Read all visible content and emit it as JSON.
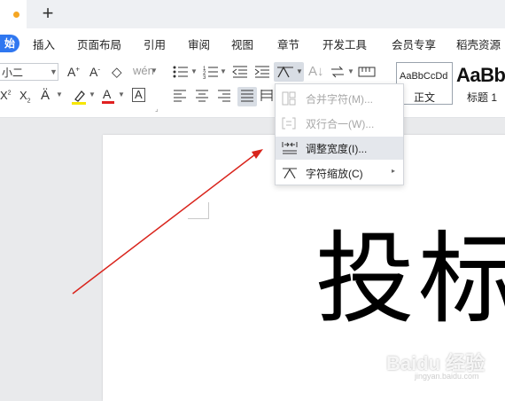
{
  "menu": {
    "start": "始",
    "items": [
      "插入",
      "页面布局",
      "引用",
      "审阅",
      "视图",
      "章节",
      "开发工具",
      "会员专享",
      "稻壳资源"
    ]
  },
  "ribbon": {
    "font_size": "小二",
    "styles": {
      "normal_sample": "AaBbCcDd",
      "normal_label": "正文",
      "heading_sample": "AaBb",
      "heading_label": "标题 1"
    }
  },
  "dropdown": {
    "items": [
      {
        "label": "合并字符(M)...",
        "enabled": false,
        "icon": "combine-chars-icon"
      },
      {
        "label": "双行合一(W)...",
        "enabled": false,
        "icon": "two-lines-in-one-icon"
      },
      {
        "label": "调整宽度(I)...",
        "enabled": true,
        "icon": "adjust-width-icon",
        "highlighted": true
      },
      {
        "label": "字符缩放(C)",
        "enabled": true,
        "icon": "char-scale-icon",
        "submenu": true
      }
    ]
  },
  "document": {
    "text": "投标"
  },
  "watermark": {
    "main": "Baidu 经验",
    "sub": "jingyan.baidu.com"
  },
  "colors": {
    "accent": "#2f77f0",
    "annotation_arrow": "#d9241c",
    "highlight_yellow": "#f7e600",
    "font_color_red": "#e02020"
  }
}
